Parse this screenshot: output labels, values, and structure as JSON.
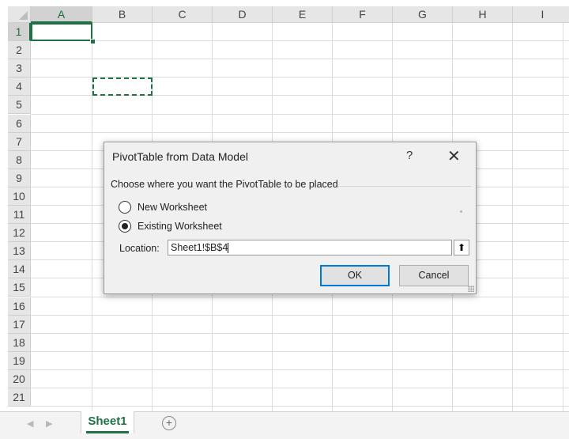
{
  "grid": {
    "columns": [
      "A",
      "B",
      "C",
      "D",
      "E",
      "F",
      "G",
      "H",
      "I"
    ],
    "rows": [
      "1",
      "2",
      "3",
      "4",
      "5",
      "6",
      "7",
      "8",
      "9",
      "10",
      "11",
      "12",
      "13",
      "14",
      "15",
      "16",
      "17",
      "18",
      "19",
      "20",
      "21"
    ]
  },
  "sheet_tabs": {
    "active_label": "Sheet1",
    "add_icon": "+",
    "prev_arrow": "◀",
    "next_arrow": "▶"
  },
  "dialog": {
    "title": "PivotTable from Data Model",
    "help_label": "?",
    "close_label": "✕",
    "prompt": "Choose where you want the PivotTable to be placed",
    "options": [
      {
        "label": "New Worksheet",
        "checked": false
      },
      {
        "label": "Existing Worksheet",
        "checked": true
      }
    ],
    "location_label": "Location:",
    "location_value": "Sheet1!$B$4",
    "ref_icon": "⬆",
    "ok_label": "OK",
    "cancel_label": "Cancel"
  },
  "colors": {
    "accent": "#1e7145",
    "focus": "#0078d7"
  }
}
